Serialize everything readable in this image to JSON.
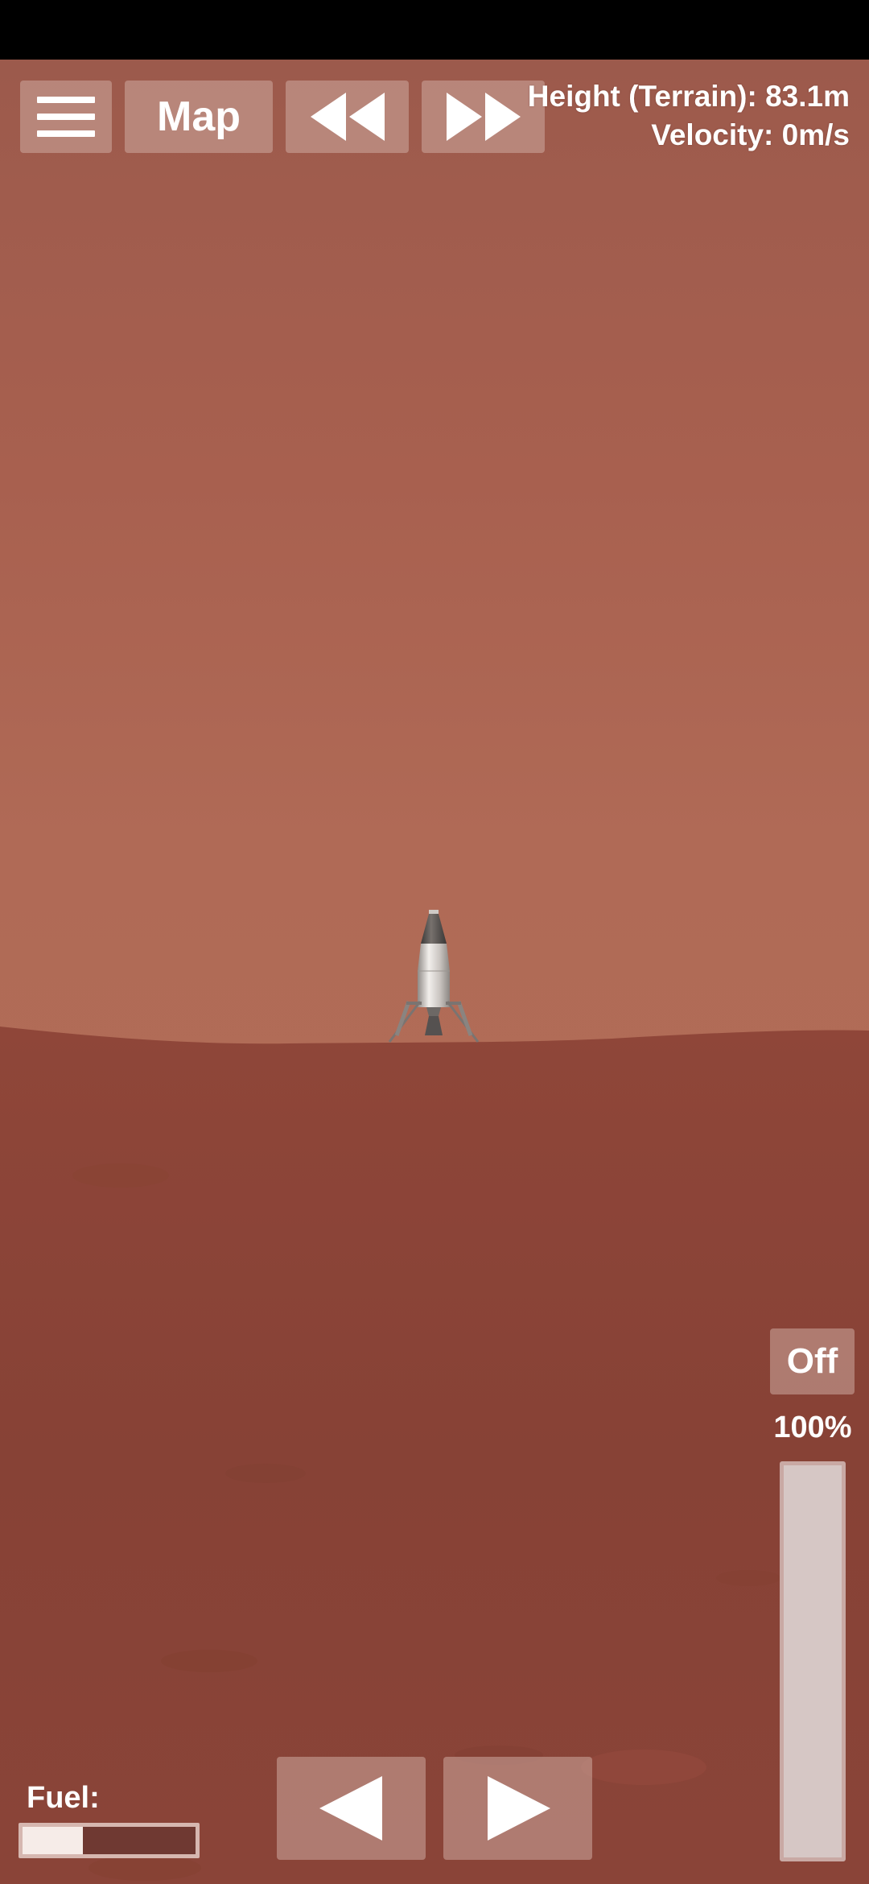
{
  "toolbar": {
    "menu_icon": "hamburger-menu-icon",
    "map_label": "Map",
    "rewind_icon": "rewind-icon",
    "fast_forward_icon": "fast-forward-icon"
  },
  "telemetry": {
    "height_text": "Height (Terrain): 83.1m",
    "velocity_text": "Velocity: 0m/s"
  },
  "throttle": {
    "engine_toggle_label": "Off",
    "percent_label": "100%",
    "level": 1.0
  },
  "controls": {
    "rotate_left_icon": "triangle-left-icon",
    "rotate_right_icon": "triangle-right-icon"
  },
  "fuel": {
    "label": "Fuel:",
    "level": 0.35
  },
  "colors": {
    "sky": "#b06a56",
    "ground": "#8b4438",
    "button_bg": "#cdaaa0",
    "text": "#ffffff"
  }
}
